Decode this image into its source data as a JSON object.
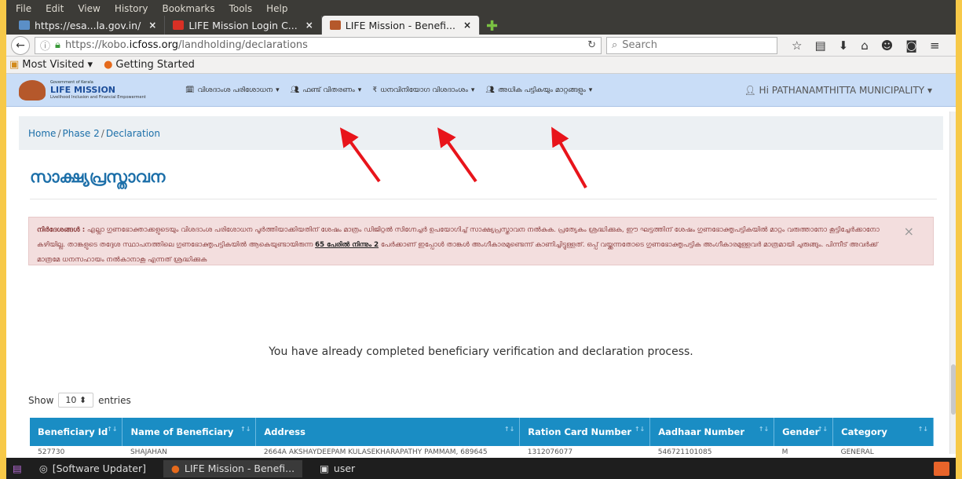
{
  "browser": {
    "menubar": [
      "File",
      "Edit",
      "View",
      "History",
      "Bookmarks",
      "Tools",
      "Help"
    ],
    "tabs": [
      {
        "label": "https://esa...la.gov.in/"
      },
      {
        "label": "LIFE Mission Login C..."
      },
      {
        "label": "LIFE Mission - Benefi...",
        "active": true
      }
    ],
    "url_prefix": "https://kobo.",
    "url_domain": "icfoss.org",
    "url_path": "/landholding/declarations",
    "search_placeholder": "Search",
    "bookmarks": [
      "Most Visited ▾",
      "Getting Started"
    ]
  },
  "app": {
    "logo_gov": "Government of Kerala",
    "logo_title": "LIFE MISSION",
    "logo_sub": "Livelihood Inclusion and Financial Empowerment",
    "menu": [
      {
        "label": "വിശദാംശ പരിശോധന",
        "icon": "calendar-icon"
      },
      {
        "label": "ഫണ്ട് വിതരണം",
        "icon": "users-icon"
      },
      {
        "label": "ധനവിനിയോഗ വിശദാംശം",
        "icon": "rupee-icon"
      },
      {
        "label": "അധിക പട്ടികയും മാറ്റങ്ങളും",
        "icon": "users-icon"
      }
    ],
    "user_greeting": "Hi PATHANAMTHITTA MUNICIPALITY"
  },
  "breadcrumb": [
    "Home",
    "Phase 2",
    "Declaration"
  ],
  "page_title": "സാക്ഷ്യപ്രസ്താവന",
  "alert": {
    "label": "നിർദേശങ്ങൾ :",
    "text_a": "എല്ലാ ഗുണഭോക്താക്കളുടെയും വിശദാംശ പരിശോധന പൂർത്തിയാക്കിയതിന് ശേഷം മാത്രം ഡിജിറ്റൽ സിഗ്നേച്ചർ ഉപയോഗിച്ച് സാക്ഷ്യപ്രസ്താവന നൽകുക. പ്രത്യേകം ശ്രദ്ധിക്കുക, ഈ ഘട്ടത്തിന് ശേഷം ഗുണഭോക്തൃപട്ടികയിൽ മാറ്റം വരുത്താനോ കൂട്ടിച്ചേർക്കാനോ കഴിയില്ല. താങ്കളുടെ തദ്ദേശ സ്ഥാപനത്തിലെ ഗുണഭോക്തൃപട്ടികയിൽ ആകെയുണ്ടായിരുന്ന",
    "highlight": "65 പേരിൽ നിന്നും 2",
    "text_b": "പേർക്കാണ് ഇപ്പോൾ താങ്കൾ അംഗീകാരമുണ്ടെന്ന് കാണിച്ചിട്ടുള്ളത്. ഒപ്പ് വയ്ക്കുന്നതോടെ ഗുണഭോക്തൃപട്ടിക അംഗീകാരമുള്ളവർ മാത്രമായി ചുരുങ്ങും. പിന്നീട് അവർക്ക് മാത്രമേ ധനസഹായം നൽകാനാകൂ എന്നത് ശ്രദ്ധിക്കുക",
    "close": "×"
  },
  "message": "You have already completed beneficiary verification and declaration process.",
  "table_controls": {
    "show": "Show",
    "entries_value": "10",
    "entries": "entries"
  },
  "table": {
    "headers": [
      "Beneficiary Id",
      "Name of Beneficiary",
      "Address",
      "Ration Card Number",
      "Aadhaar Number",
      "Gender",
      "Category"
    ],
    "row": [
      "527730",
      "SHAJAHAN",
      "2664A AKSHAYDEEPAM KULASEKHARAPATHY PAMMAM, 689645",
      "1312076077",
      "546721101085",
      "M",
      "GENERAL"
    ]
  },
  "taskbar": [
    {
      "label": "[Software Updater]"
    },
    {
      "label": "LIFE Mission - Benefi..."
    },
    {
      "label": "user"
    }
  ],
  "colors": {
    "accent": "#1a8dc4",
    "arrow": "#e8141b",
    "header_bg": "#c9ddf7"
  }
}
